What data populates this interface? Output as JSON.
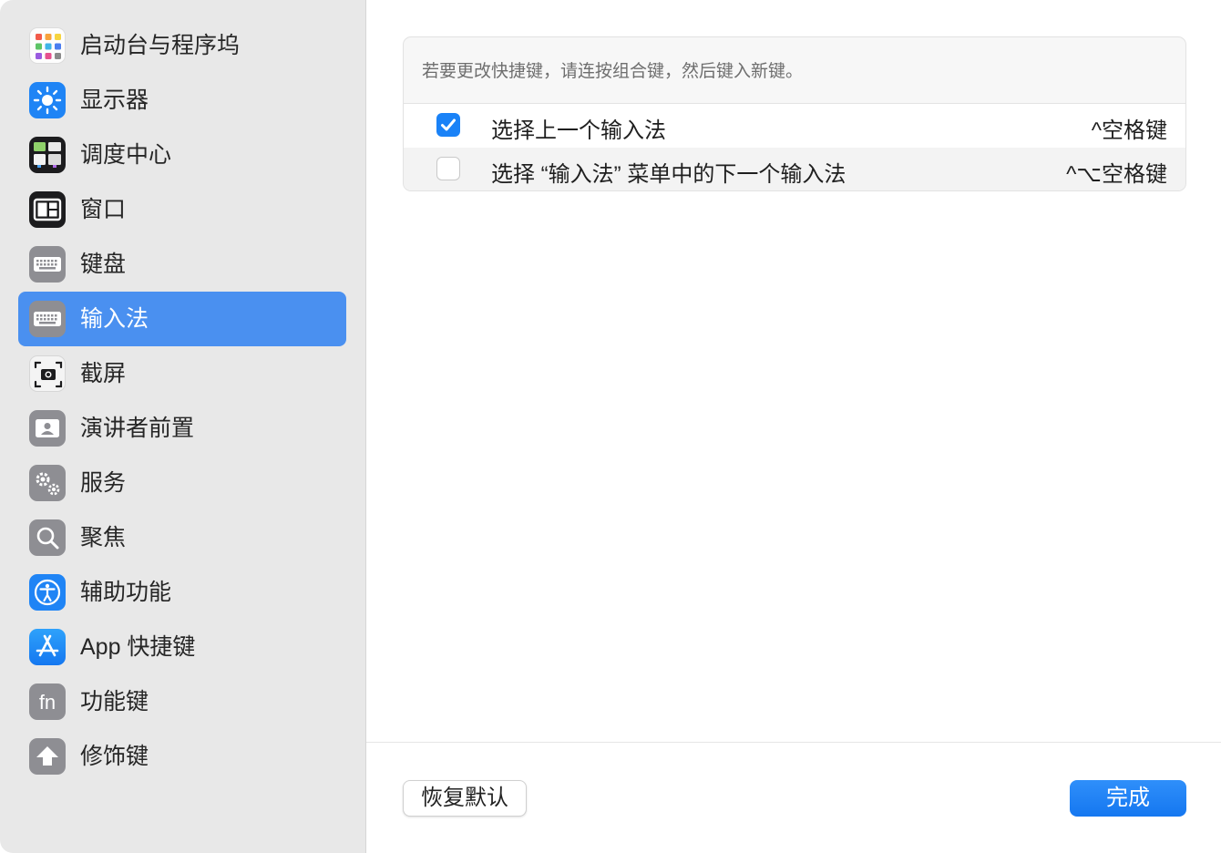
{
  "sidebar": {
    "items": [
      {
        "label": "启动台与程序坞",
        "icon": "launchpad-icon"
      },
      {
        "label": "显示器",
        "icon": "display-brightness-icon"
      },
      {
        "label": "调度中心",
        "icon": "mission-control-icon"
      },
      {
        "label": "窗口",
        "icon": "window-icon"
      },
      {
        "label": "键盘",
        "icon": "keyboard-icon"
      },
      {
        "label": "输入法",
        "icon": "keyboard-icon",
        "selected": true
      },
      {
        "label": "截屏",
        "icon": "screenshot-icon"
      },
      {
        "label": "演讲者前置",
        "icon": "presenter-overlay-icon"
      },
      {
        "label": "服务",
        "icon": "gears-icon"
      },
      {
        "label": "聚焦",
        "icon": "magnifier-icon"
      },
      {
        "label": "辅助功能",
        "icon": "accessibility-icon"
      },
      {
        "label": "App 快捷键",
        "icon": "app-store-icon"
      },
      {
        "label": "功能键",
        "icon": "fn-key-icon"
      },
      {
        "label": "修饰键",
        "icon": "up-arrow-key-icon"
      }
    ]
  },
  "panel": {
    "hint": "若要更改快捷键，请连按组合键，然后键入新键。",
    "rows": [
      {
        "label": "选择上一个输入法",
        "shortcut": "^空格键",
        "checked": true
      },
      {
        "label": "选择 “输入法” 菜单中的下一个输入法",
        "shortcut": "^⌥空格键",
        "checked": false
      }
    ]
  },
  "footer": {
    "reset_label": "恢复默认",
    "done_label": "完成"
  },
  "colors": {
    "accent": "#1a82f7",
    "sidebar_selected": "#4a90f0",
    "sidebar_bg": "#e8e8e8"
  }
}
